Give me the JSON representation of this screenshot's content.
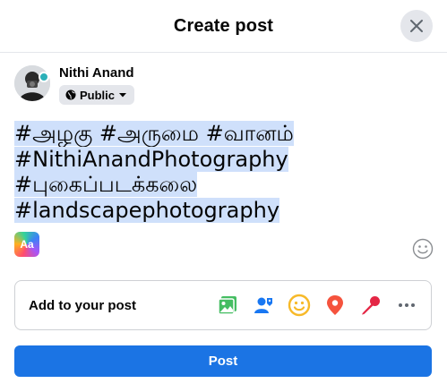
{
  "dialog": {
    "title": "Create post"
  },
  "user": {
    "name": "Nithi Anand",
    "audience": "Public"
  },
  "composer": {
    "lines": [
      "#அழகு #அருமை #வானம்",
      "#NithiAnandPhotography",
      "#புகைப்படக்கலை",
      "#landscapephotography"
    ],
    "text_format_label": "Aa"
  },
  "add_to_post": {
    "label": "Add to your post",
    "icons": [
      "photo-video-icon",
      "tag-people-icon",
      "feeling-activity-icon",
      "check-in-icon",
      "live-video-icon",
      "more-icon"
    ]
  },
  "post_button": {
    "label": "Post"
  },
  "colors": {
    "primary": "#1b74e4",
    "selection": "#cfe0fb",
    "photo": "#45bd62",
    "tag": "#1877f2",
    "feeling": "#f7b928",
    "checkin": "#f5533d",
    "live": "#e42645"
  }
}
